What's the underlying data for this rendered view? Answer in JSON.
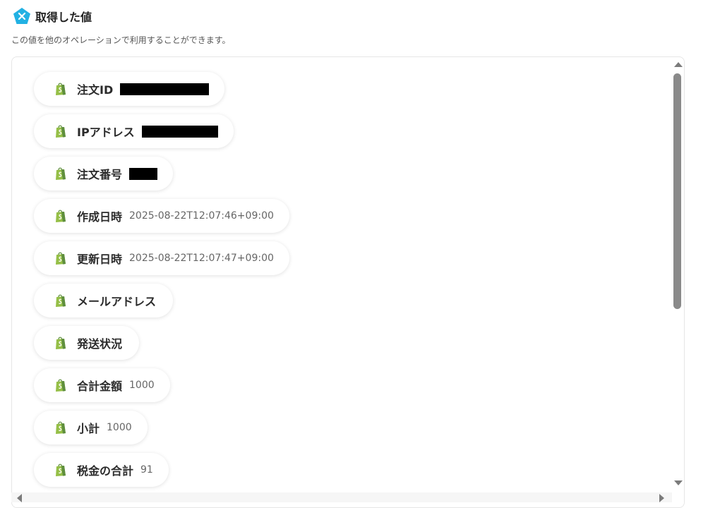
{
  "header": {
    "title": "取得した値",
    "icon": "yoom-logo-icon"
  },
  "description": "この値を他のオペレーションで利用することができます。",
  "colors": {
    "accent": "#22b1e3",
    "shopify_green": "#95bf47"
  },
  "items": [
    {
      "label": "注文ID",
      "value": "",
      "redacted": true
    },
    {
      "label": "IPアドレス",
      "value": "",
      "redacted": true
    },
    {
      "label": "注文番号",
      "value": "",
      "redacted": true
    },
    {
      "label": "作成日時",
      "value": "2025-08-22T12:07:46+09:00",
      "redacted": false
    },
    {
      "label": "更新日時",
      "value": "2025-08-22T12:07:47+09:00",
      "redacted": false
    },
    {
      "label": "メールアドレス",
      "value": "",
      "redacted": false
    },
    {
      "label": "発送状況",
      "value": "",
      "redacted": false
    },
    {
      "label": "合計金額",
      "value": "1000",
      "redacted": false
    },
    {
      "label": "小計",
      "value": "1000",
      "redacted": false
    },
    {
      "label": "税金の合計",
      "value": "91",
      "redacted": false
    }
  ]
}
